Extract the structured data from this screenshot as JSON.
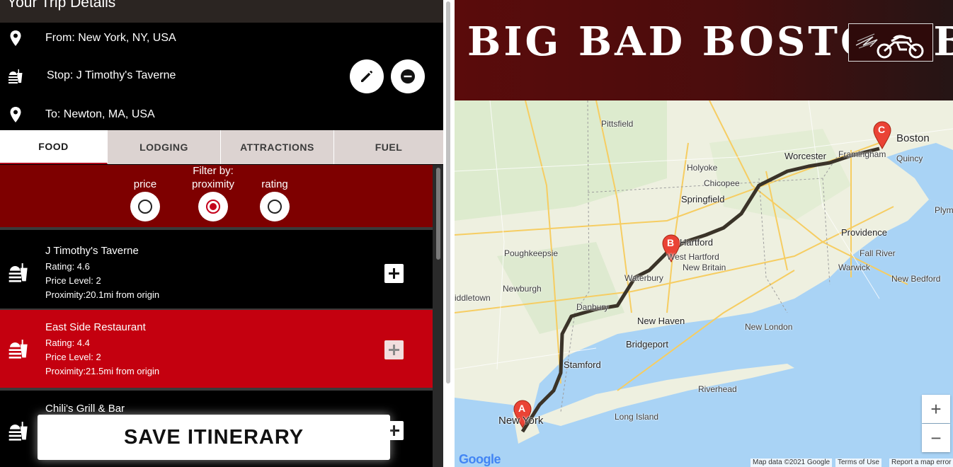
{
  "header": {
    "title": "Your Trip Details"
  },
  "trip": {
    "from": "From: New York, NY, USA",
    "stop": "Stop: J Timothy's Taverne",
    "to": "To: Newton, MA, USA"
  },
  "tabs": [
    {
      "label": "FOOD",
      "active": true
    },
    {
      "label": "LODGING",
      "active": false
    },
    {
      "label": "ATTRACTIONS",
      "active": false
    },
    {
      "label": "FUEL",
      "active": false
    }
  ],
  "filter": {
    "title": "Filter by:",
    "options": [
      {
        "label": "price",
        "selected": false
      },
      {
        "label": "proximity",
        "selected": true
      },
      {
        "label": "rating",
        "selected": false
      }
    ]
  },
  "results": [
    {
      "name": "J Timothy's Taverne",
      "rating": "Rating: 4.6",
      "price": "Price Level: 2",
      "proximity": "Proximity:20.1mi from origin"
    },
    {
      "name": "East Side Restaurant",
      "rating": "Rating: 4.4",
      "price": "Price Level: 2",
      "proximity": "Proximity:21.5mi from origin"
    },
    {
      "name": "Chili's Grill & Bar",
      "rating": "",
      "price": "",
      "proximity": ""
    }
  ],
  "save_button": "SAVE ITINERARY",
  "banner": {
    "title": "BIG BAD BOSTON B"
  },
  "map": {
    "markers": [
      "A",
      "B",
      "C"
    ],
    "labels": {
      "pittsfield": "Pittsfield",
      "worcester": "Worcester",
      "framingham": "Framingham",
      "boston": "Boston",
      "quincy": "Quincy",
      "holyoke": "Holyoke",
      "chicopee": "Chicopee",
      "springfield": "Springfield",
      "plymouth": "Plym",
      "providence": "Providence",
      "hartford": "Hartford",
      "west_hartford": "West Hartford",
      "new_britain": "New Britain",
      "poughkeepsie": "Poughkeepsie",
      "fall_river": "Fall River",
      "warwick": "Warwick",
      "waterbury": "Waterbury",
      "new_bedford": "New Bedford",
      "newburgh": "Newburgh",
      "middletown": "iddletown",
      "danbury": "Danbury",
      "new_haven": "New Haven",
      "new_london": "New London",
      "bridgeport": "Bridgeport",
      "stamford": "Stamford",
      "riverhead": "Riverhead",
      "long_island": "Long Island",
      "new_york": "New York"
    },
    "zoom_in": "+",
    "zoom_out": "−",
    "attribution": {
      "data": "Map data ©2021 Google",
      "terms": "Terms of Use",
      "report": "Report a map error"
    },
    "logo": "Google"
  },
  "colors": {
    "accent_red": "#c4000f",
    "dark_red": "#7e0000",
    "route": "#3a3328"
  }
}
